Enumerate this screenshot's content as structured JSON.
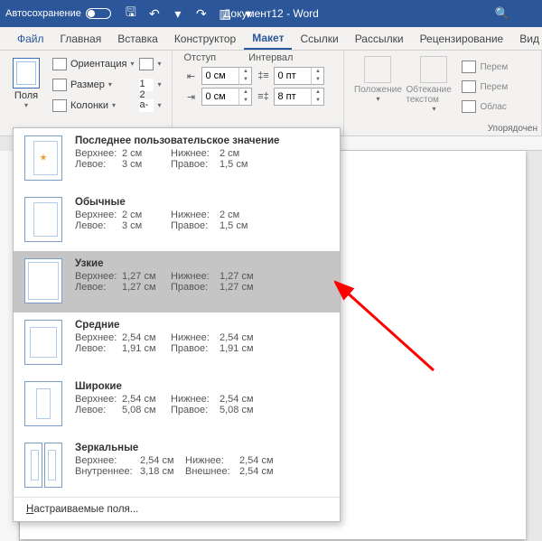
{
  "titlebar": {
    "autosave": "Автосохранение",
    "doc_title": "Документ12 - Word"
  },
  "tabs": {
    "file": "Файл",
    "home": "Главная",
    "insert": "Вставка",
    "design": "Конструктор",
    "layout": "Макет",
    "references": "Ссылки",
    "mailings": "Рассылки",
    "review": "Рецензирование",
    "view": "Вид"
  },
  "ribbon": {
    "margins_btn": "Поля",
    "orientation": "Ориентация",
    "size": "Размер",
    "columns": "Колонки",
    "indent_label": "Отступ",
    "spacing_label": "Интервал",
    "indent_left": "0 см",
    "indent_right": "0 см",
    "spacing_before": "0 пт",
    "spacing_after": "8 пт",
    "position": "Положение",
    "wrap": "Обтекание текстом",
    "bring_fwd": "Перем",
    "send_back": "Перем",
    "selection": "Облас",
    "arrange_label": "Упорядочен"
  },
  "menu": {
    "items": [
      {
        "title": "Последнее пользовательское значение",
        "top_l": "Верхнее:",
        "top_v": "2 см",
        "bot_l": "Нижнее:",
        "bot_v": "2 см",
        "left_l": "Левое:",
        "left_v": "3 см",
        "right_l": "Правое:",
        "right_v": "1,5 см",
        "inner": "top:5px;bottom:5px;left:9px;right:4px",
        "star": true
      },
      {
        "title": "Обычные",
        "top_l": "Верхнее:",
        "top_v": "2 см",
        "bot_l": "Нижнее:",
        "bot_v": "2 см",
        "left_l": "Левое:",
        "left_v": "3 см",
        "right_l": "Правое:",
        "right_v": "1,5 см",
        "inner": "top:5px;bottom:5px;left:9px;right:4px"
      },
      {
        "title": "Узкие",
        "top_l": "Верхнее:",
        "top_v": "1,27 см",
        "bot_l": "Нижнее:",
        "bot_v": "1,27 см",
        "left_l": "Левое:",
        "left_v": "1,27 см",
        "right_l": "Правое:",
        "right_v": "1,27 см",
        "inner": "top:3px;bottom:3px;left:3px;right:3px",
        "hover": true
      },
      {
        "title": "Средние",
        "top_l": "Верхнее:",
        "top_v": "2,54 см",
        "bot_l": "Нижнее:",
        "bot_v": "2,54 см",
        "left_l": "Левое:",
        "left_v": "1,91 см",
        "right_l": "Правое:",
        "right_v": "1,91 см",
        "inner": "top:7px;bottom:7px;left:5px;right:5px"
      },
      {
        "title": "Широкие",
        "top_l": "Верхнее:",
        "top_v": "2,54 см",
        "bot_l": "Нижнее:",
        "bot_v": "2,54 см",
        "left_l": "Левое:",
        "left_v": "5,08 см",
        "right_l": "Правое:",
        "right_v": "5,08 см",
        "inner": "top:7px;bottom:7px;left:12px;right:12px"
      },
      {
        "title": "Зеркальные",
        "top_l": "Верхнее:",
        "top_v": "2,54 см",
        "bot_l": "Нижнее:",
        "bot_v": "2,54 см",
        "left_l": "Внутреннее:",
        "left_v": "3,18 см",
        "right_l": "Внешнее:",
        "right_v": "2,54 см",
        "mirror": true
      }
    ],
    "custom": "Настраиваемые поля..."
  }
}
